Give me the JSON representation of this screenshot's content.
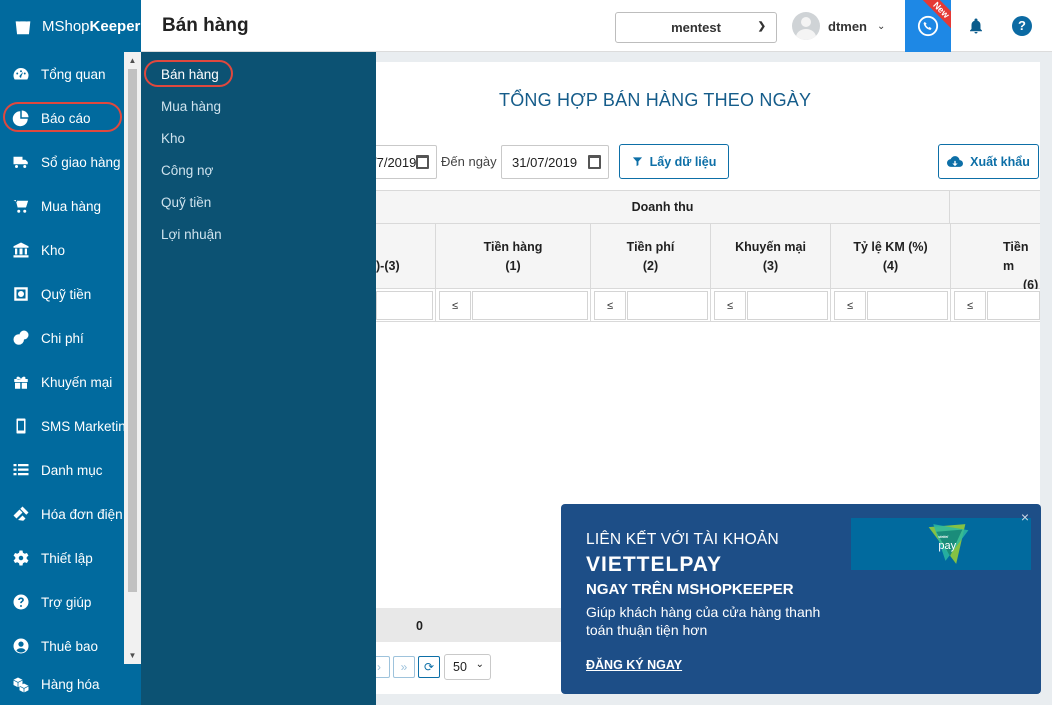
{
  "app": {
    "logo_prefix": "MShop",
    "logo_bold": "Keeper"
  },
  "header": {
    "title": "Bán hàng",
    "store": "mentest",
    "user": "dtmen",
    "new_badge": "New",
    "help": "?"
  },
  "sidebar": {
    "items": [
      {
        "label": "Tổng quan",
        "icon": "dashboard-icon"
      },
      {
        "label": "Báo cáo",
        "icon": "pie-chart-icon"
      },
      {
        "label": "Sổ giao hàng",
        "icon": "truck-icon"
      },
      {
        "label": "Mua hàng",
        "icon": "cart-icon"
      },
      {
        "label": "Kho",
        "icon": "warehouse-icon"
      },
      {
        "label": "Quỹ tiền",
        "icon": "safe-icon"
      },
      {
        "label": "Chi phí",
        "icon": "money-icon"
      },
      {
        "label": "Khuyến mại",
        "icon": "gift-icon"
      },
      {
        "label": "SMS Marketing",
        "icon": "phone-icon"
      },
      {
        "label": "Danh mục",
        "icon": "list-icon"
      },
      {
        "label": "Hóa đơn điện tử",
        "icon": "invoice-icon"
      },
      {
        "label": "Thiết lập",
        "icon": "gear-icon"
      },
      {
        "label": "Trợ giúp",
        "icon": "help-icon"
      },
      {
        "label": "Thuê bao",
        "icon": "user-icon"
      }
    ],
    "bottom": {
      "label": "Hàng hóa",
      "icon": "boxes-icon"
    }
  },
  "submenu": {
    "items": [
      "Bán hàng",
      "Mua hàng",
      "Kho",
      "Công nợ",
      "Quỹ tiền",
      "Lợi nhuận"
    ]
  },
  "report": {
    "title": "TỔNG HỢP BÁN HÀNG THEO NGÀY",
    "from_date_partial": "/7/2019",
    "to_label": "Đến ngày",
    "to_date": "31/07/2019",
    "get_button": "Lấy dữ liệu",
    "export_button": "Xuất khẩu",
    "group_header": "Doanh thu",
    "columns": [
      {
        "name": ")-(3)",
        "num": ""
      },
      {
        "name": "Tiền hàng",
        "num": "(1)"
      },
      {
        "name": "Tiền phí",
        "num": "(2)"
      },
      {
        "name": "Khuyến mại",
        "num": "(3)"
      },
      {
        "name": "Tỷ lệ KM (%)",
        "num": "(4)"
      },
      {
        "name": "Tiền m",
        "num": "(6)"
      }
    ],
    "filter_op": "≤",
    "total_value": "0",
    "page_size": "50"
  },
  "promo": {
    "line1": "LIÊN KẾT VỚI TÀI KHOẢN",
    "line2": "VIETTELPAY",
    "line3": "NGAY TRÊN MSHOPKEEPER",
    "line4": "Giúp khách hàng của cửa hàng thanh toán thuận tiện hơn",
    "cta": "ĐĂNG KÝ NGAY",
    "logo_small": "viettel",
    "logo_big": "pay",
    "close": "×"
  },
  "colors": {
    "sidebar": "#016a9e",
    "submenu": "#0c5273",
    "accent": "#0d6fa7",
    "highlight": "#e0483e",
    "promo": "#1d4e87"
  }
}
